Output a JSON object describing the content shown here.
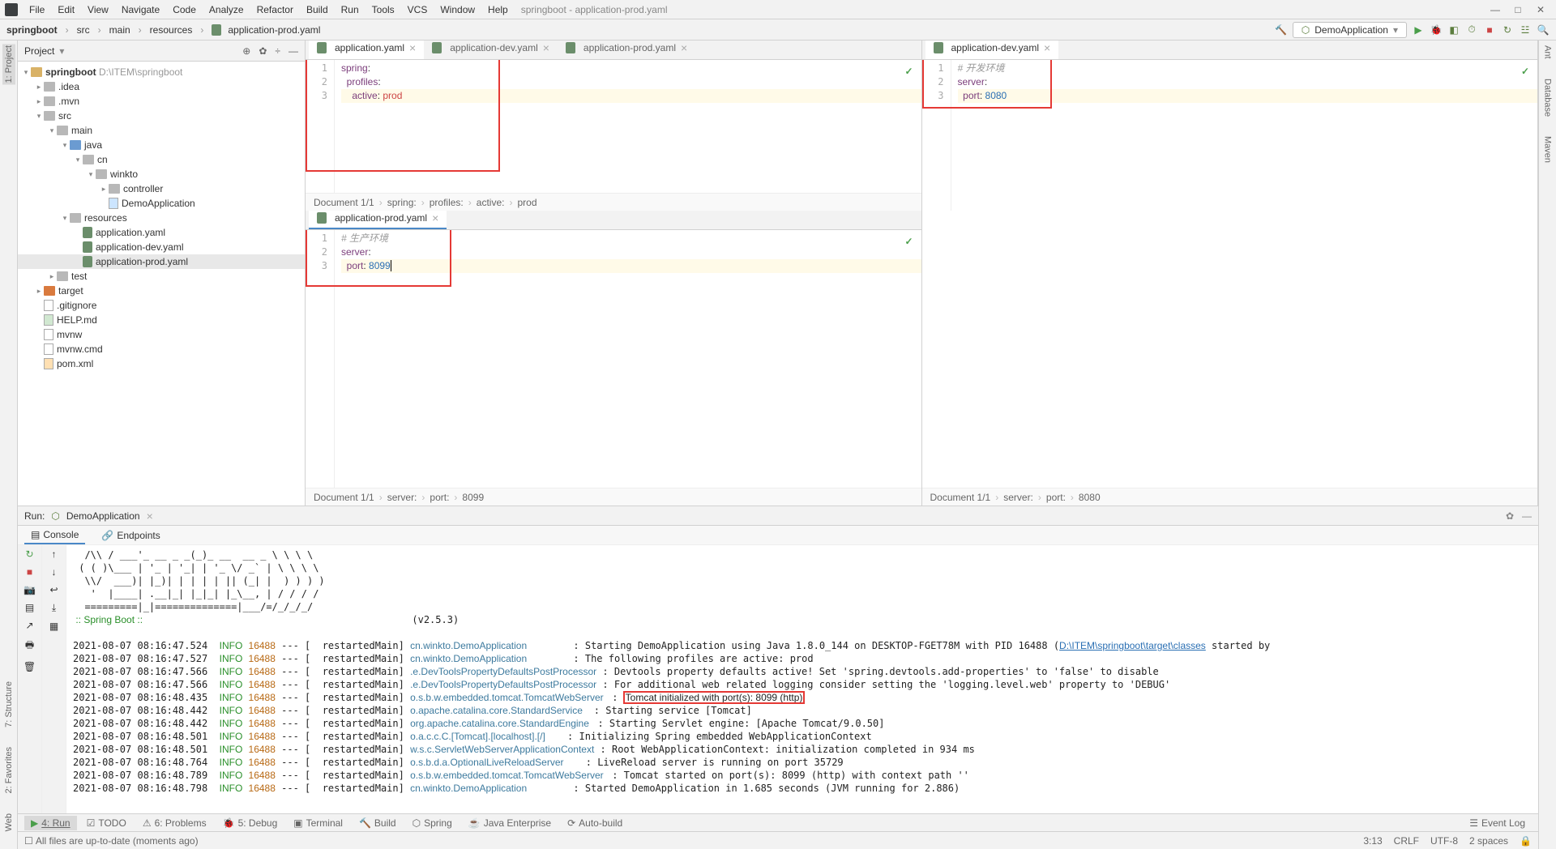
{
  "title_context": "springboot - application-prod.yaml",
  "menu": [
    "File",
    "Edit",
    "View",
    "Navigate",
    "Code",
    "Analyze",
    "Refactor",
    "Build",
    "Run",
    "Tools",
    "VCS",
    "Window",
    "Help"
  ],
  "win": {
    "min": "—",
    "max": "□",
    "close": "✕"
  },
  "breadcrumbs": [
    "springboot",
    "src",
    "main",
    "resources",
    "application-prod.yaml"
  ],
  "run_config": "DemoApplication",
  "run_config_arrow": "▾",
  "hammer_icon": "⚙",
  "project_label": "Project",
  "project_arrow": "▾",
  "project_icons": {
    "target": "⊕",
    "gear": "✿",
    "collapse": "—",
    "hide": "—"
  },
  "tree": {
    "root": "springboot",
    "root_path": "D:\\ITEM\\springboot",
    "idea": ".idea",
    "mvn": ".mvn",
    "src": "src",
    "main": "main",
    "java": "java",
    "cn": "cn",
    "winkto": "winkto",
    "controller": "controller",
    "demoapp": "DemoApplication",
    "resources": "resources",
    "app_yaml": "application.yaml",
    "app_dev": "application-dev.yaml",
    "app_prod": "application-prod.yaml",
    "test": "test",
    "target": "target",
    "gitignore": ".gitignore",
    "help": "HELP.md",
    "mvnw": "mvnw",
    "mvnw_cmd": "mvnw.cmd",
    "pom": "pom.xml"
  },
  "left_tools": {
    "project": "1: Project",
    "structure": "7: Structure",
    "favorites": "2: Favorites",
    "web": "Web"
  },
  "right_tools": {
    "ant": "Ant",
    "database": "Database",
    "maven": "Maven"
  },
  "tabs_top": [
    "application.yaml",
    "application-dev.yaml",
    "application-prod.yaml"
  ],
  "tab_right": "application-dev.yaml",
  "tab_bottom": "application-prod.yaml",
  "editor_app": {
    "l1": "spring",
    "l2": "profiles",
    "l3": "active",
    "val": "prod",
    "crumb_doc": "Document 1/1",
    "crumb": [
      "spring:",
      "profiles:",
      "active:",
      "prod"
    ]
  },
  "editor_dev": {
    "comment": "# 开发环境",
    "l2": "server",
    "l3": "port",
    "val": "8080",
    "crumb_doc": "Document 1/1",
    "crumb": [
      "server:",
      "port:",
      "8080"
    ]
  },
  "editor_prod": {
    "comment": "# 生产环境",
    "l2": "server",
    "l3": "port",
    "val": "8099",
    "crumb_doc": "Document 1/1",
    "crumb": [
      "server:",
      "port:",
      "8099"
    ]
  },
  "run": {
    "label": "Run:",
    "name": "DemoApplication",
    "console": "Console",
    "endpoints": "Endpoints"
  },
  "banner": {
    "l1": "  /\\\\ / ___'_ __ _ _(_)_ __  __ _ \\ \\ \\ \\",
    "l2": " ( ( )\\___ | '_ | '_| | '_ \\/ _` | \\ \\ \\ \\",
    "l3": "  \\\\/  ___)| |_)| | | | | || (_| |  ) ) ) )",
    "l4": "   '  |____| .__|_| |_|_| |_\\__, | / / / /",
    "l5": "  =========|_|==============|___/=/_/_/_/",
    "boot": " :: Spring Boot ::",
    "version": "(v2.5.3)"
  },
  "logs": [
    {
      "ts": "2021-08-07 08:16:47.524",
      "lvl": "INFO",
      "pid": "16488",
      "th": "restartedMain",
      "cls": "cn.winkto.DemoApplication",
      "msg1": "Starting DemoApplication using Java 1.8.0_144 on DESKTOP-FGET78M with PID 16488 (",
      "link": "D:\\ITEM\\springboot\\target\\classes",
      "msg2": " started by"
    },
    {
      "ts": "2021-08-07 08:16:47.527",
      "lvl": "INFO",
      "pid": "16488",
      "th": "restartedMain",
      "cls": "cn.winkto.DemoApplication",
      "msg": "The following profiles are active: prod"
    },
    {
      "ts": "2021-08-07 08:16:47.566",
      "lvl": "INFO",
      "pid": "16488",
      "th": "restartedMain",
      "cls": ".e.DevToolsPropertyDefaultsPostProcessor",
      "msg": "Devtools property defaults active! Set 'spring.devtools.add-properties' to 'false' to disable"
    },
    {
      "ts": "2021-08-07 08:16:47.566",
      "lvl": "INFO",
      "pid": "16488",
      "th": "restartedMain",
      "cls": ".e.DevToolsPropertyDefaultsPostProcessor",
      "msg": "For additional web related logging consider setting the 'logging.level.web' property to 'DEBUG'"
    },
    {
      "ts": "2021-08-07 08:16:48.435",
      "lvl": "INFO",
      "pid": "16488",
      "th": "restartedMain",
      "cls": "o.s.b.w.embedded.tomcat.TomcatWebServer",
      "msg": "Tomcat initialized with port(s): 8099 (http)",
      "hi": true
    },
    {
      "ts": "2021-08-07 08:16:48.442",
      "lvl": "INFO",
      "pid": "16488",
      "th": "restartedMain",
      "cls": "o.apache.catalina.core.StandardService",
      "msg": "Starting service [Tomcat]"
    },
    {
      "ts": "2021-08-07 08:16:48.442",
      "lvl": "INFO",
      "pid": "16488",
      "th": "restartedMain",
      "cls": "org.apache.catalina.core.StandardEngine",
      "msg": "Starting Servlet engine: [Apache Tomcat/9.0.50]"
    },
    {
      "ts": "2021-08-07 08:16:48.501",
      "lvl": "INFO",
      "pid": "16488",
      "th": "restartedMain",
      "cls": "o.a.c.c.C.[Tomcat].[localhost].[/]",
      "msg": "Initializing Spring embedded WebApplicationContext"
    },
    {
      "ts": "2021-08-07 08:16:48.501",
      "lvl": "INFO",
      "pid": "16488",
      "th": "restartedMain",
      "cls": "w.s.c.ServletWebServerApplicationContext",
      "msg": "Root WebApplicationContext: initialization completed in 934 ms"
    },
    {
      "ts": "2021-08-07 08:16:48.764",
      "lvl": "INFO",
      "pid": "16488",
      "th": "restartedMain",
      "cls": "o.s.b.d.a.OptionalLiveReloadServer",
      "msg": "LiveReload server is running on port 35729"
    },
    {
      "ts": "2021-08-07 08:16:48.789",
      "lvl": "INFO",
      "pid": "16488",
      "th": "restartedMain",
      "cls": "o.s.b.w.embedded.tomcat.TomcatWebServer",
      "msg": "Tomcat started on port(s): 8099 (http) with context path ''"
    },
    {
      "ts": "2021-08-07 08:16:48.798",
      "lvl": "INFO",
      "pid": "16488",
      "th": "restartedMain",
      "cls": "cn.winkto.DemoApplication",
      "msg": "Started DemoApplication in 1.685 seconds (JVM running for 2.886)"
    }
  ],
  "bottom_tabs": {
    "run": "4: Run",
    "todo": "TODO",
    "problems": "6: Problems",
    "debug": "5: Debug",
    "terminal": "Terminal",
    "build": "Build",
    "spring": "Spring",
    "javaee": "Java Enterprise",
    "autobuild": "Auto-build",
    "eventlog": "Event Log"
  },
  "status": {
    "msg": "All files are up-to-date (moments ago)",
    "pos": "3:13",
    "crlf": "CRLF",
    "enc": "UTF-8",
    "indent": "2 spaces",
    "lock": "🔒"
  }
}
